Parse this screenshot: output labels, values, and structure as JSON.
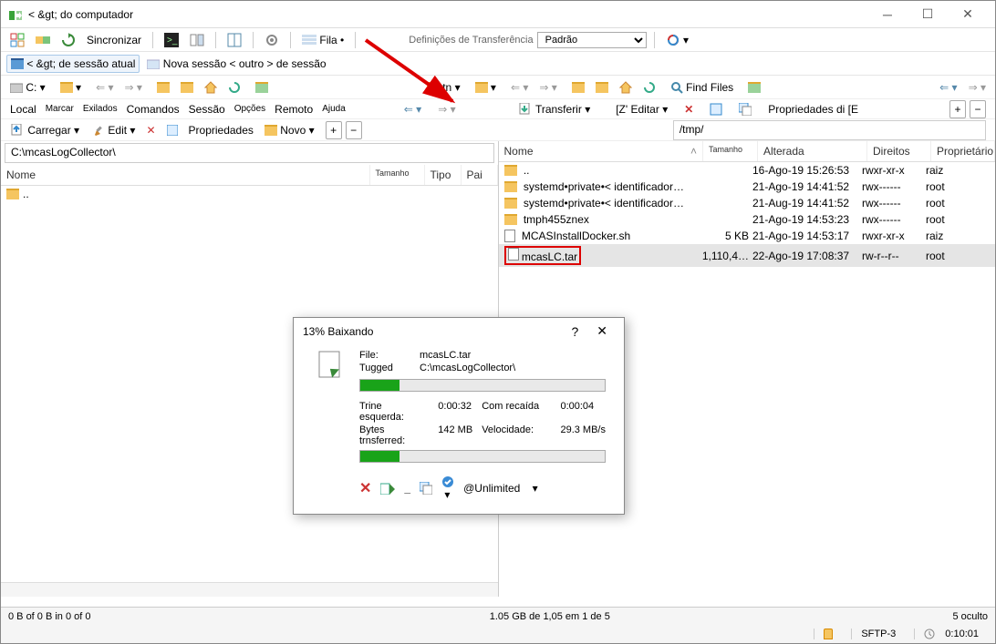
{
  "window": {
    "title": "< &gt; do computador"
  },
  "toolbar1": {
    "sync_label": "Sincronizar",
    "queue_label": "Fila",
    "transfer_label": "Definições de Transferência",
    "preset": "Padrão"
  },
  "tabs": {
    "session_label": "< &gt; de sessão atual",
    "new_session": "Nova sessão < outro > de sessão"
  },
  "menu": {
    "local": "Local",
    "mark": "Marcar",
    "exilados": "Exilados",
    "commands": "Comandos",
    "session": "Sessão",
    "options": "Opções",
    "remote": "Remoto",
    "help": "Ajuda"
  },
  "toolbar3_left": {
    "drive": "C:"
  },
  "toolbar3_right": {
    "drive": "tn",
    "find_files": "Find Files"
  },
  "toolbar4": {
    "carregar": "Carregar",
    "edit": "Edit",
    "propriedades": "Propriedades",
    "novo": "Novo",
    "transferir": "Transferir",
    "editar": "[Z' Editar",
    "propriedades_de": "Propriedades di [E"
  },
  "left_pane": {
    "path": "C:\\mcasLogCollector\\",
    "columns": {
      "name": "Nome",
      "tamanho": "Tamanho",
      "tipo": "Tipo",
      "pai": "Pai"
    },
    "rows": [
      {
        "name": ".."
      }
    ]
  },
  "right_pane": {
    "path": "/tmp/",
    "columns": {
      "name": "Nome",
      "tamanho": "Tamanho",
      "alterada": "Alterada",
      "direitos": "Direitos",
      "prop": "Proprietário"
    },
    "rows": [
      {
        "name": "..",
        "type": "up",
        "size": "",
        "date": "16-Ago-19 15:26:53",
        "rights": "rwxr-xr-x",
        "owner": "raiz"
      },
      {
        "name": "systemd•private•< identificador…",
        "type": "folder",
        "size": "",
        "date": "21-Ago-19 14:41:52",
        "rights": "rwx------",
        "owner": "root"
      },
      {
        "name": "systemd•private•< identificador…",
        "type": "folder",
        "size": "",
        "date": "21-Aug-19 14:41:52",
        "rights": "rwx------",
        "owner": "root"
      },
      {
        "name": "tmph455znex",
        "type": "folder",
        "size": "",
        "date": "21-Ago-19 14:53:23",
        "rights": "rwx------",
        "owner": "root"
      },
      {
        "name": "MCASInstallDocker.sh",
        "type": "file",
        "size": "5 KB",
        "date": "21-Ago-19 14:53:17",
        "rights": "rwxr-xr-x",
        "owner": "raiz"
      },
      {
        "name": "mcasLC.tar",
        "type": "file",
        "size": "1,110,4…",
        "date": "22-Ago-19 17:08:37",
        "rights": "rw-r--r--",
        "owner": "root"
      }
    ]
  },
  "status": {
    "left": "0 B of 0 B in 0 of 0",
    "center": "1.05 GB de 1,05 em 1 de 5",
    "right": "5 oculto",
    "protocol": "SFTP-3",
    "time": "0:10:01"
  },
  "dialog": {
    "percent": "13%",
    "title": "Baixando",
    "file_label": "File:",
    "file_val": "mcasLC.tar",
    "tugged_label": "Tugged",
    "tugged_val": "C:\\mcasLogCollector\\",
    "time_left_label": "Trine esquerda:",
    "time_left_val": "0:00:32",
    "comrecaida_label": "Com recaída",
    "comrecaida_val": "0:00:04",
    "bytes_label": "Bytes trnsferred:",
    "bytes_val": "142 MB",
    "speed_label": "Velocidade:",
    "speed_val": "29.3 MB/s",
    "unlimited": "@Unlimited"
  }
}
